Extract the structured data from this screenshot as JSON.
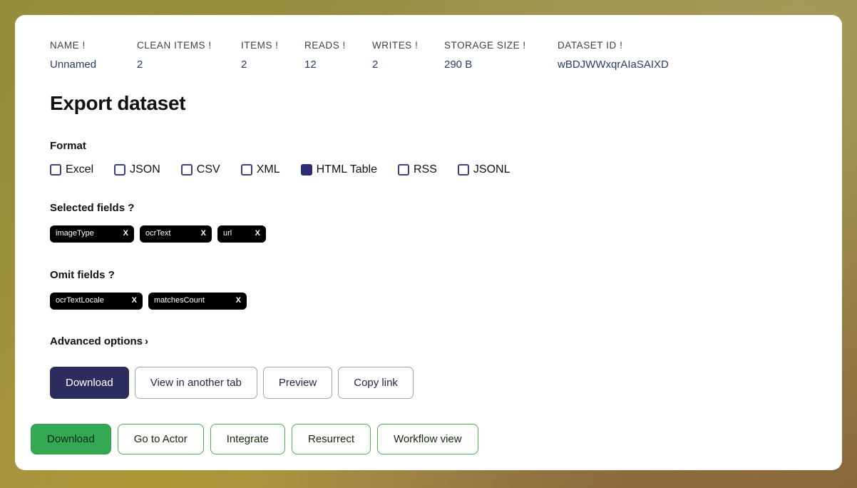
{
  "stats": [
    {
      "label": "NAME !",
      "value": "Unnamed",
      "key": "name"
    },
    {
      "label": "CLEAN ITEMS !",
      "value": "2",
      "key": "clean-items"
    },
    {
      "label": "ITEMS !",
      "value": "2",
      "key": "items"
    },
    {
      "label": "READS !",
      "value": "12",
      "key": "reads"
    },
    {
      "label": "WRITES !",
      "value": "2",
      "key": "writes"
    },
    {
      "label": "STORAGE SIZE !",
      "value": "290 B",
      "key": "storage-size"
    },
    {
      "label": "DATASET ID !",
      "value": "wBDJWWxqrAIaSAIXD",
      "key": "dataset-id"
    }
  ],
  "page": {
    "title": "Export dataset"
  },
  "format": {
    "heading": "Format",
    "options": [
      {
        "label": "Excel",
        "checked": false
      },
      {
        "label": "JSON",
        "checked": false
      },
      {
        "label": "CSV",
        "checked": false
      },
      {
        "label": "XML",
        "checked": false
      },
      {
        "label": "HTML Table",
        "checked": true
      },
      {
        "label": "RSS",
        "checked": false
      },
      {
        "label": "JSONL",
        "checked": false
      }
    ]
  },
  "selected_fields": {
    "heading": "Selected fields ?",
    "tags": [
      {
        "label": "imageType",
        "remove": "X"
      },
      {
        "label": "ocrText",
        "remove": "X"
      },
      {
        "label": "url",
        "remove": "X"
      }
    ]
  },
  "omit_fields": {
    "heading": "Omit fields ?",
    "tags": [
      {
        "label": "ocrTextLocale",
        "remove": "X"
      },
      {
        "label": "matchesCount",
        "remove": "X"
      }
    ]
  },
  "advanced": {
    "label": "Advanced options",
    "caret": "›"
  },
  "actions": [
    {
      "label": "Download",
      "style": "primary"
    },
    {
      "label": "View in another tab",
      "style": "outline"
    },
    {
      "label": "Preview",
      "style": "outline"
    },
    {
      "label": "Copy link",
      "style": "outline"
    }
  ],
  "footer_actions": [
    {
      "label": "Download",
      "style": "green"
    },
    {
      "label": "Go to Actor",
      "style": "outline"
    },
    {
      "label": "Integrate",
      "style": "outline"
    },
    {
      "label": "Resurrect",
      "style": "outline"
    },
    {
      "label": "Workflow view",
      "style": "outline"
    }
  ],
  "colors": {
    "accent_navy": "#2c2c5e",
    "checkbox_checked": "#2c2c6e",
    "stat_value": "#2b3a67",
    "green": "#34a853",
    "tag_bg": "#000000"
  }
}
